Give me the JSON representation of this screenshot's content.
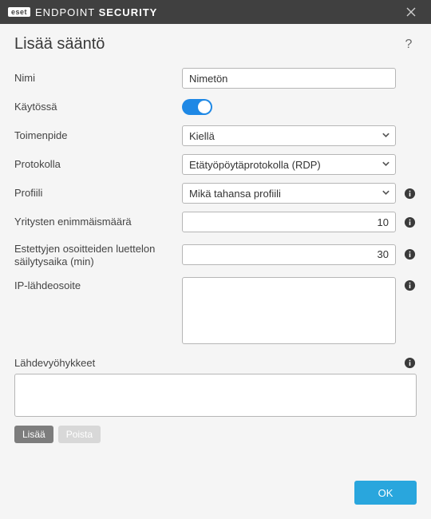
{
  "titlebar": {
    "brand_badge": "eset",
    "brand_light": "ENDPOINT ",
    "brand_bold": "SECURITY"
  },
  "heading": "Lisää sääntö",
  "help_glyph": "?",
  "labels": {
    "name": "Nimi",
    "enabled": "Käytössä",
    "action": "Toimenpide",
    "protocol": "Protokolla",
    "profile": "Profiili",
    "max_attempts": "Yritysten enimmäismäärä",
    "block_retention": "Estettyjen osoitteiden luettelon säilytysaika (min)",
    "ip_source": "IP-lähdeosoite",
    "source_zones": "Lähdevyöhykkeet"
  },
  "fields": {
    "name_value": "Nimetön",
    "enabled": true,
    "action_value": "Kiellä",
    "protocol_value": "Etätyöpöytäprotokolla (RDP)",
    "profile_value": "Mikä tahansa profiili",
    "max_attempts_value": "10",
    "block_retention_value": "30",
    "ip_source_value": "",
    "source_zones_value": ""
  },
  "buttons": {
    "add": "Lisää",
    "remove": "Poista",
    "ok": "OK"
  }
}
